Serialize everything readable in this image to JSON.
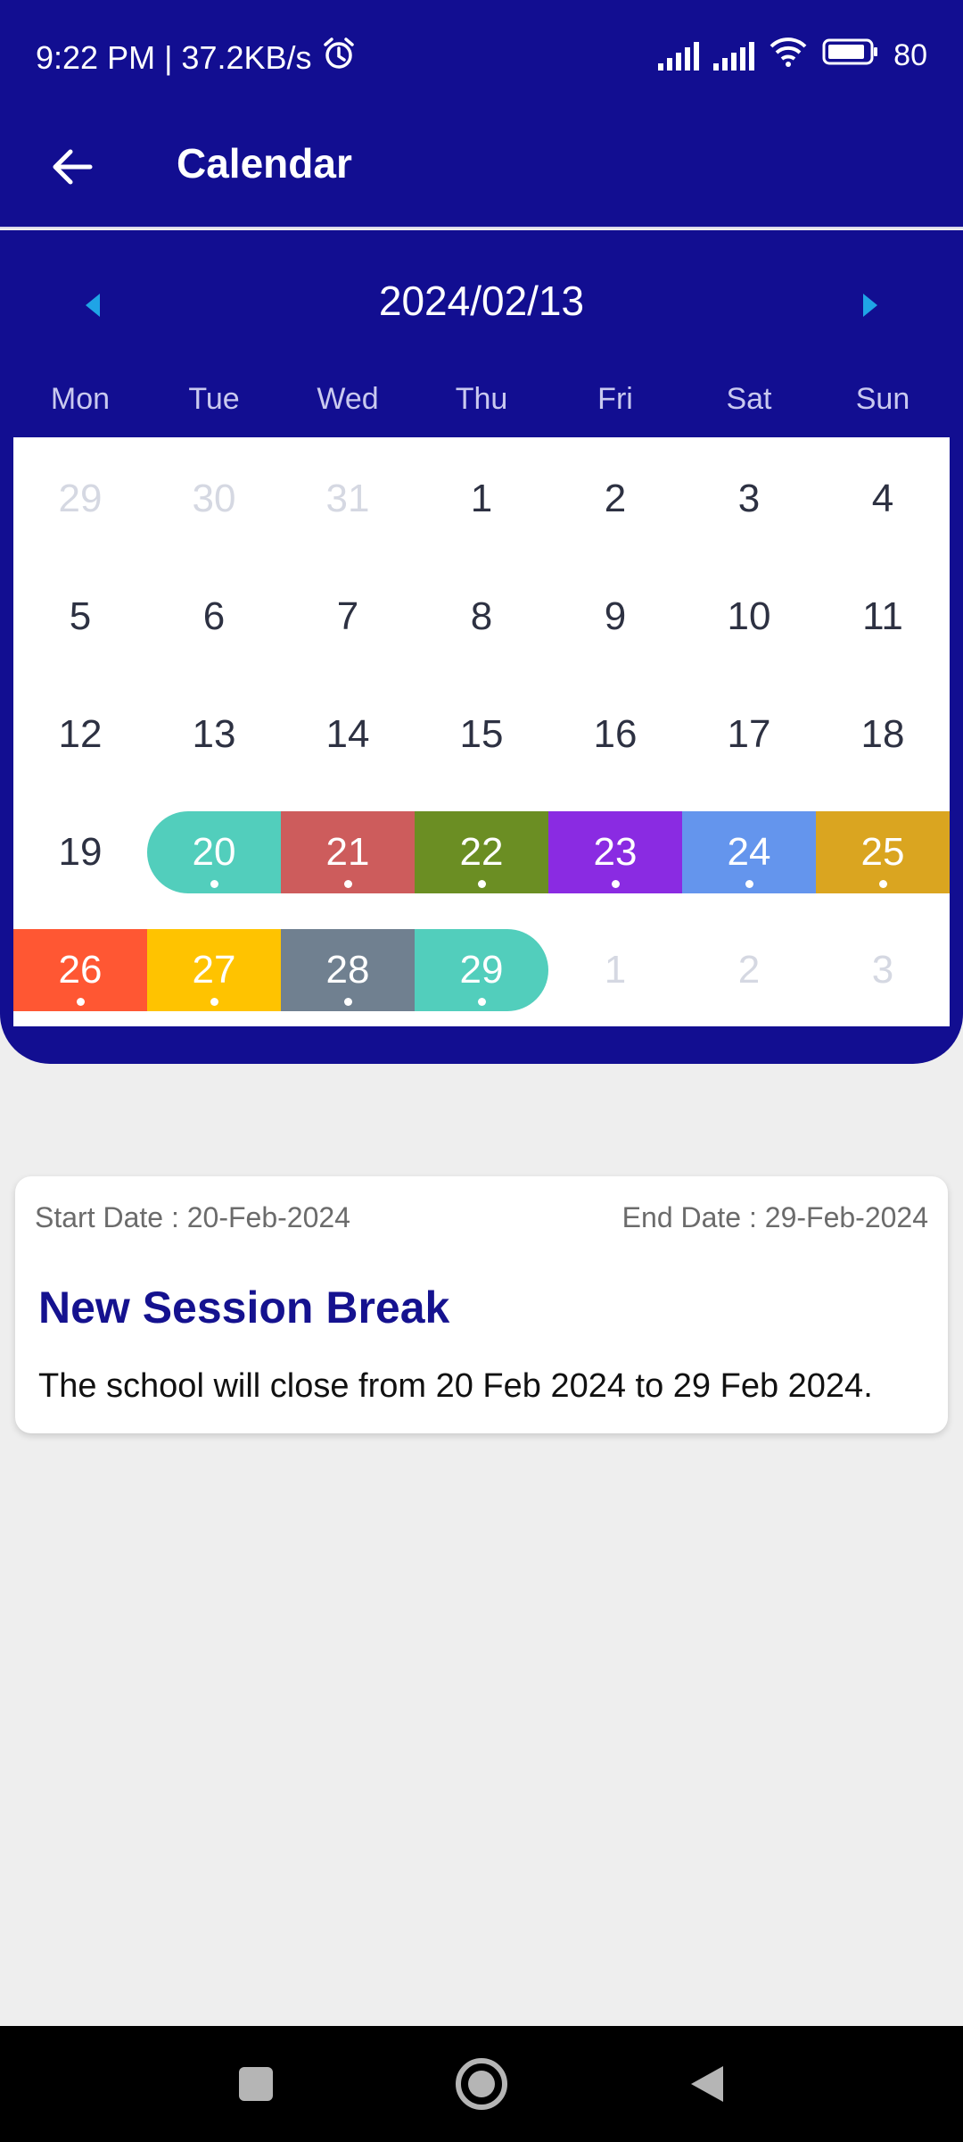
{
  "status": {
    "time": "9:22 PM | 37.2KB/s",
    "battery": "80"
  },
  "icons": {
    "alarm": "alarm-clock-icon",
    "signal": "signal-bars-icon",
    "wifi": "wifi-icon",
    "battery": "battery-icon",
    "back": "arrow-left-icon",
    "prev": "triangle-left-icon",
    "next": "triangle-right-icon",
    "recents": "square-icon",
    "home": "circle-home-icon",
    "nav_back": "triangle-back-icon"
  },
  "appbar": {
    "title": "Calendar"
  },
  "calendar": {
    "month_label": "2024/02/13",
    "weekdays": [
      "Mon",
      "Tue",
      "Wed",
      "Thu",
      "Fri",
      "Sat",
      "Sun"
    ],
    "weeks": [
      [
        "29",
        "30",
        "31",
        "1",
        "2",
        "3",
        "4"
      ],
      [
        "5",
        "6",
        "7",
        "8",
        "9",
        "10",
        "11"
      ],
      [
        "12",
        "13",
        "14",
        "15",
        "16",
        "17",
        "18"
      ],
      [
        "19",
        "20",
        "21",
        "22",
        "23",
        "24",
        "25"
      ],
      [
        "26",
        "27",
        "28",
        "29",
        "1",
        "2",
        "3"
      ]
    ],
    "muted_days": [
      "29-jan",
      "30-jan",
      "31-jan",
      "1-mar",
      "2-mar",
      "3-mar"
    ],
    "event_colors": {
      "20": "#52cebc",
      "21": "#cd5c5c",
      "22": "#6b8e23",
      "23": "#8a2be2",
      "24": "#6495ed",
      "25": "#daa520",
      "26": "#ff5733",
      "27": "#ffc300",
      "28": "#708090",
      "29": "#52cebc"
    }
  },
  "event": {
    "start": "Start Date : 20-Feb-2024",
    "end": "End Date : 29-Feb-2024",
    "title": "New Session Break",
    "description": "The school will close from 20 Feb 2024 to 29 Feb 2024."
  },
  "colors": {
    "primary": "#120e91",
    "background": "#eeeeee"
  }
}
